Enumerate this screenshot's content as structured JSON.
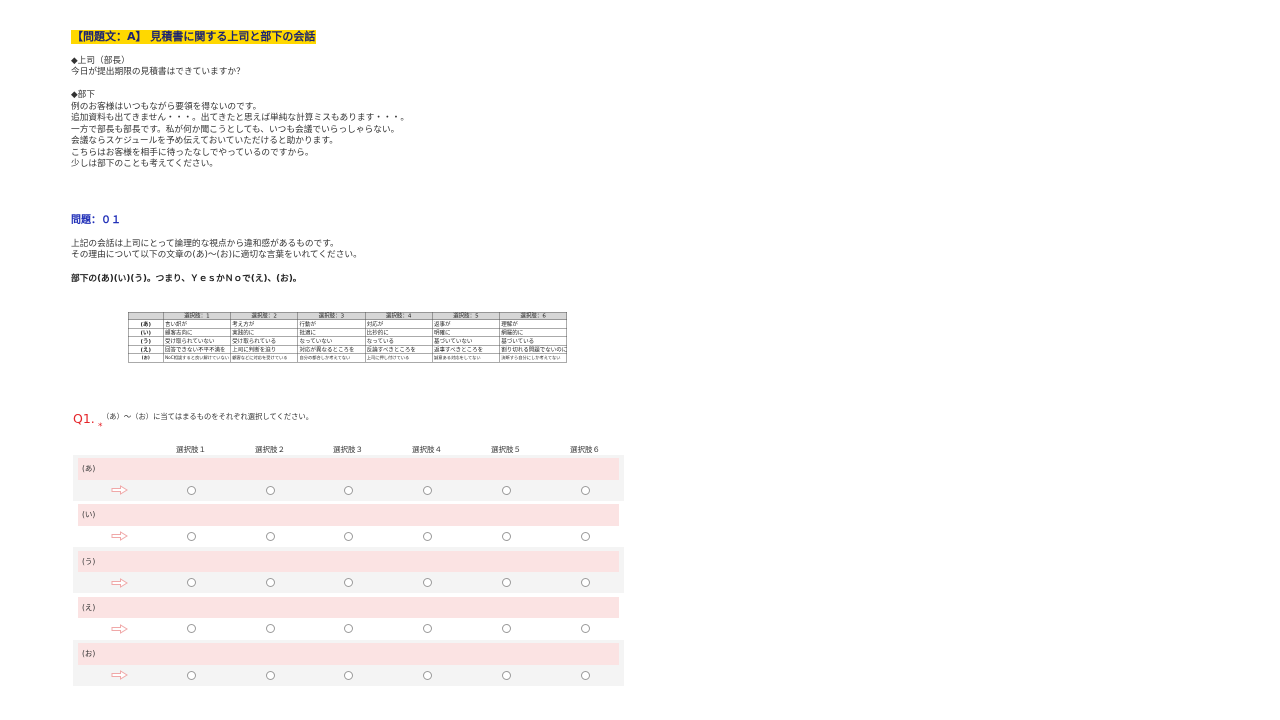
{
  "title": "【問題文：A】 見積書に関する上司と部下の会話",
  "conversation": {
    "boss_heading": "◆上司（部長）",
    "boss_lines": [
      "今日が提出期限の見積書はできていますか？"
    ],
    "subordinate_heading": "◆部下",
    "subordinate_lines": [
      "例のお客様はいつもながら要領を得ないのです。",
      "追加資料も出てきません・・・。出てきたと思えば単純な計算ミスもあります・・・。",
      "一方で部長も部長です。私が何か聞こうとしても、いつも会議でいらっしゃらない。",
      "会議ならスケジュールを予め伝えておいていただけると助かります。",
      "こちらはお客様を相手に待ったなしでやっているのですから。",
      "少しは部下のことも考えてください。"
    ]
  },
  "problem": {
    "heading": "問題：０１",
    "lines": [
      "上記の会話は上司にとって論理的な視点から違和感があるものです。",
      "その理由について以下の文章の(あ)〜(お)に適切な言葉をいれてください。"
    ],
    "sentence": "部下の(あ)(い)(う)。つまり、ＹｅｓかＮｏで(え)、(お)。"
  },
  "options_table": {
    "headers": [
      "選択肢：1",
      "選択肢：2",
      "選択肢：3",
      "選択肢：4",
      "選択肢：5",
      "選択肢：6"
    ],
    "rows": [
      {
        "label": "(あ)",
        "cells": [
          "言い訳が",
          "考え方が",
          "行動が",
          "対応が",
          "返事が",
          "理解が"
        ]
      },
      {
        "label": "(い)",
        "cells": [
          "顧客志向に",
          "実践的に",
          "批適に",
          "比抄的に",
          "明確に",
          "網羅的に"
        ]
      },
      {
        "label": "(う)",
        "cells": [
          "受け取られていない",
          "受け取られている",
          "なっていない",
          "なっている",
          "基づいていない",
          "基づいている"
        ]
      },
      {
        "label": "(え)",
        "cells": [
          "回答できない不平不満を",
          "上司に判断を迫り",
          "対応が異なるところを",
          "反論すべきところを",
          "返事すべきところを",
          "割り切れる問題でないのに"
        ]
      },
      {
        "label": "(お)",
        "cells": [
          "NoC相談すると良い解けていない",
          "顧客などに対応を受けている",
          "自分の都合しか考えてない",
          "上司に押し付けている",
          "誠意ある対応をしてない",
          "決断すら自分にしか考えてない"
        ]
      }
    ]
  },
  "q1": {
    "number": "Q1.",
    "text": "（あ）〜（お）に当てはまるものをそれぞれ選択してください。",
    "required_mark": "*",
    "columns": [
      "選択肢１",
      "選択肢２",
      "選択肢３",
      "選択肢４",
      "選択肢５",
      "選択肢６"
    ],
    "row_icon": "arrow-right-icon",
    "rows": [
      {
        "label": "(あ)"
      },
      {
        "label": "(い)"
      },
      {
        "label": "(う)"
      },
      {
        "label": "(え)"
      },
      {
        "label": "(お)"
      }
    ]
  },
  "colors": {
    "title_highlight": "#ffd800",
    "title_text": "#1c2470",
    "heading_blue": "#2130b8",
    "required_red": "#e5252a",
    "row_label_bg": "#fbe3e3",
    "stripe_bg": "#f4f4f4",
    "arrow": "#f0a8a8"
  }
}
